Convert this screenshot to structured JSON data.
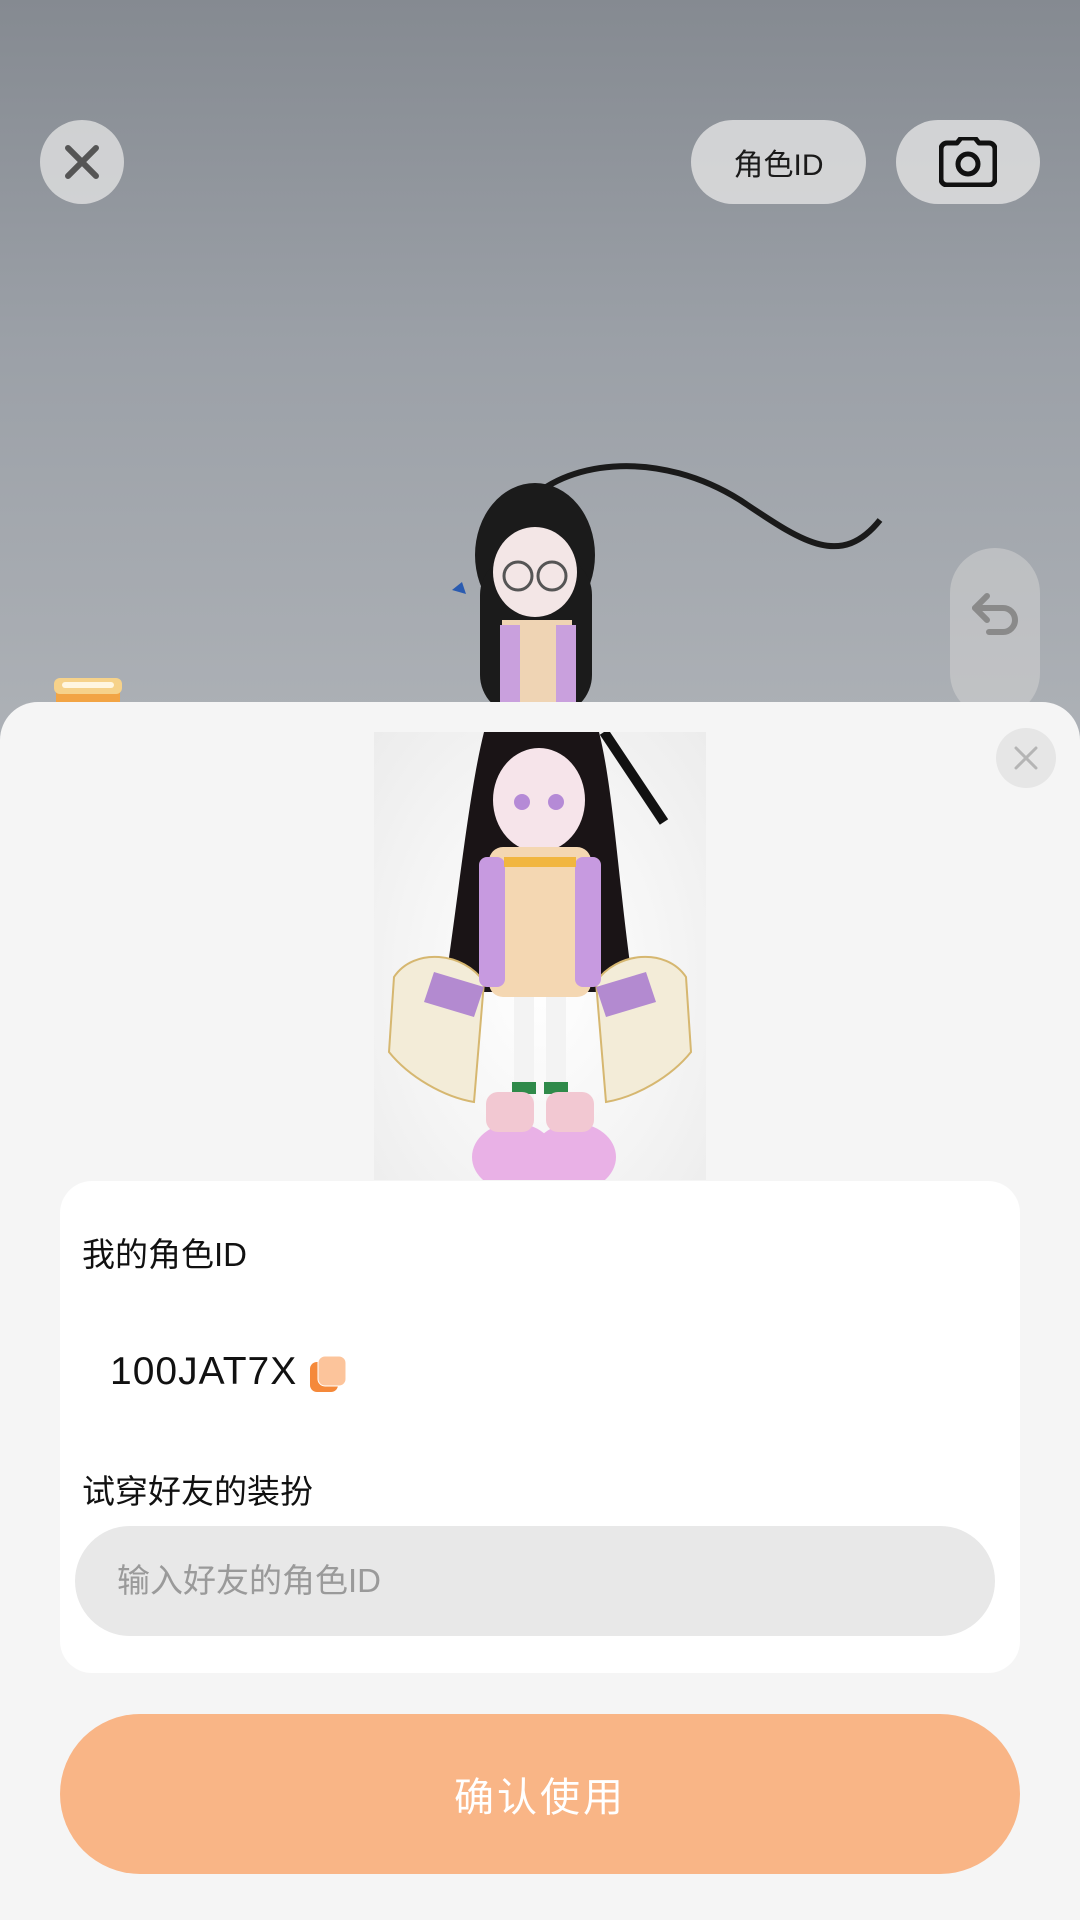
{
  "top_bar": {
    "close_icon": "close-icon",
    "role_id_label": "角色ID",
    "camera_icon": "camera-icon"
  },
  "side": {
    "undo_icon": "undo-icon"
  },
  "sheet": {
    "close_icon": "close-icon",
    "my_id_label": "我的角色ID",
    "my_id_value": "100JAT7X",
    "copy_icon": "copy-icon",
    "try_label": "试穿好友的装扮",
    "friend_input": {
      "value": "",
      "placeholder": "输入好友的角色ID"
    },
    "confirm_label": "确认使用"
  },
  "colors": {
    "accent": "#f9b586",
    "copy_icon": "#f5893a"
  }
}
